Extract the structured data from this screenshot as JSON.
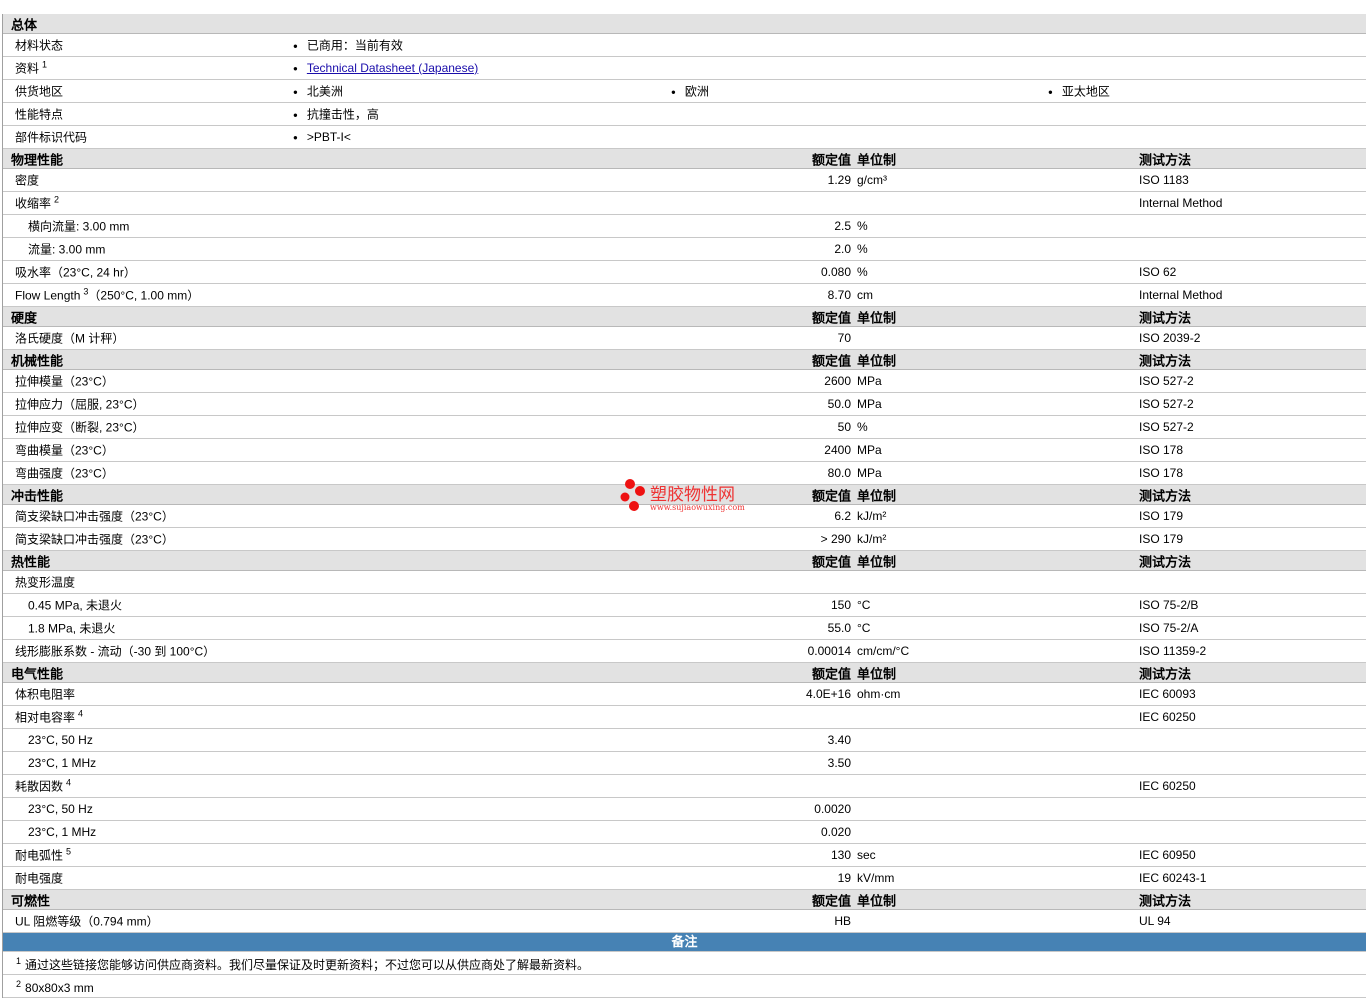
{
  "general": {
    "title": "总体",
    "rows": [
      {
        "label": "材料状态",
        "items": [
          "已商用：当前有效"
        ]
      },
      {
        "label": "资料",
        "sup": "1",
        "link": "Technical Datasheet (Japanese)"
      },
      {
        "label": "供货地区",
        "items": [
          "北美洲",
          "欧洲",
          "亚太地区"
        ]
      },
      {
        "label": "性能特点",
        "items": [
          "抗撞击性，高"
        ]
      },
      {
        "label": "部件标识代码",
        "items": [
          ">PBT-I<"
        ]
      }
    ]
  },
  "col_headers": {
    "value": "额定值",
    "unit": "单位制",
    "test": "测试方法"
  },
  "sections": [
    {
      "title": "物理性能",
      "rows": [
        {
          "label": "密度",
          "value": "1.29",
          "unit": "g/cm³",
          "test": "ISO 1183"
        },
        {
          "label": "收缩率",
          "sup": "2",
          "test": "Internal Method"
        },
        {
          "label": "横向流量: 3.00 mm",
          "sub": true,
          "value": "2.5",
          "unit": "%"
        },
        {
          "label": "流量: 3.00 mm",
          "sub": true,
          "value": "2.0",
          "unit": "%"
        },
        {
          "label": "吸水率（23°C, 24 hr）",
          "value": "0.080",
          "unit": "%",
          "test": "ISO 62"
        },
        {
          "label": "Flow Length",
          "sup": "3",
          "extra": "（250°C, 1.00 mm）",
          "value": "8.70",
          "unit": "cm",
          "test": "Internal Method"
        }
      ]
    },
    {
      "title": "硬度",
      "rows": [
        {
          "label": "洛氏硬度（M 计秤）",
          "value": "70",
          "test": "ISO 2039-2"
        }
      ]
    },
    {
      "title": "机械性能",
      "rows": [
        {
          "label": "拉伸模量（23°C）",
          "value": "2600",
          "unit": "MPa",
          "test": "ISO 527-2"
        },
        {
          "label": "拉伸应力（屈服, 23°C）",
          "value": "50.0",
          "unit": "MPa",
          "test": "ISO 527-2"
        },
        {
          "label": "拉伸应变（断裂, 23°C）",
          "value": "50",
          "unit": "%",
          "test": "ISO 527-2"
        },
        {
          "label": "弯曲模量（23°C）",
          "value": "2400",
          "unit": "MPa",
          "test": "ISO 178"
        },
        {
          "label": "弯曲强度（23°C）",
          "value": "80.0",
          "unit": "MPa",
          "test": "ISO 178"
        }
      ]
    },
    {
      "title": "冲击性能",
      "rows": [
        {
          "label": "简支梁缺口冲击强度（23°C）",
          "value": "6.2",
          "unit": "kJ/m²",
          "test": "ISO 179"
        },
        {
          "label": "简支梁缺口冲击强度（23°C）",
          "value": "> 290",
          "unit": "kJ/m²",
          "test": "ISO 179"
        }
      ]
    },
    {
      "title": "热性能",
      "rows": [
        {
          "label": "热变形温度"
        },
        {
          "label": "0.45 MPa, 未退火",
          "sub": true,
          "value": "150",
          "unit": "°C",
          "test": "ISO 75-2/B"
        },
        {
          "label": "1.8 MPa, 未退火",
          "sub": true,
          "value": "55.0",
          "unit": "°C",
          "test": "ISO 75-2/A"
        },
        {
          "label": "线形膨胀系数 - 流动（-30 到 100°C）",
          "value": "0.00014",
          "unit": "cm/cm/°C",
          "test": "ISO 11359-2"
        }
      ]
    },
    {
      "title": "电气性能",
      "rows": [
        {
          "label": "体积电阻率",
          "value": "4.0E+16",
          "unit": "ohm·cm",
          "test": "IEC 60093"
        },
        {
          "label": "相对电容率",
          "sup": "4",
          "test": "IEC 60250"
        },
        {
          "label": "23°C, 50 Hz",
          "sub": true,
          "value": "3.40"
        },
        {
          "label": "23°C, 1 MHz",
          "sub": true,
          "value": "3.50"
        },
        {
          "label": "耗散因数",
          "sup": "4",
          "test": "IEC 60250"
        },
        {
          "label": "23°C, 50 Hz",
          "sub": true,
          "value": "0.0020"
        },
        {
          "label": "23°C, 1 MHz",
          "sub": true,
          "value": "0.020"
        },
        {
          "label": "耐电弧性",
          "sup": "5",
          "value": "130",
          "unit": "sec",
          "test": "IEC 60950"
        },
        {
          "label": "耐电强度",
          "value": "19",
          "unit": "kV/mm",
          "test": "IEC 60243-1"
        }
      ]
    },
    {
      "title": "可燃性",
      "rows": [
        {
          "label": "UL 阻燃等级（0.794 mm）",
          "value": "HB",
          "test": "UL 94"
        }
      ]
    }
  ],
  "notes": {
    "title": "备注",
    "footnotes": [
      {
        "num": "1",
        "text": "通过这些链接您能够访问供应商资料。我们尽量保证及时更新资料；不过您可以从供应商处了解最新资料。"
      },
      {
        "num": "2",
        "text": "80x80x3 mm"
      }
    ]
  },
  "watermark": {
    "name": "塑胶物性网",
    "url": "www.sujiaowuxing.com",
    "color": "#ee1111"
  }
}
